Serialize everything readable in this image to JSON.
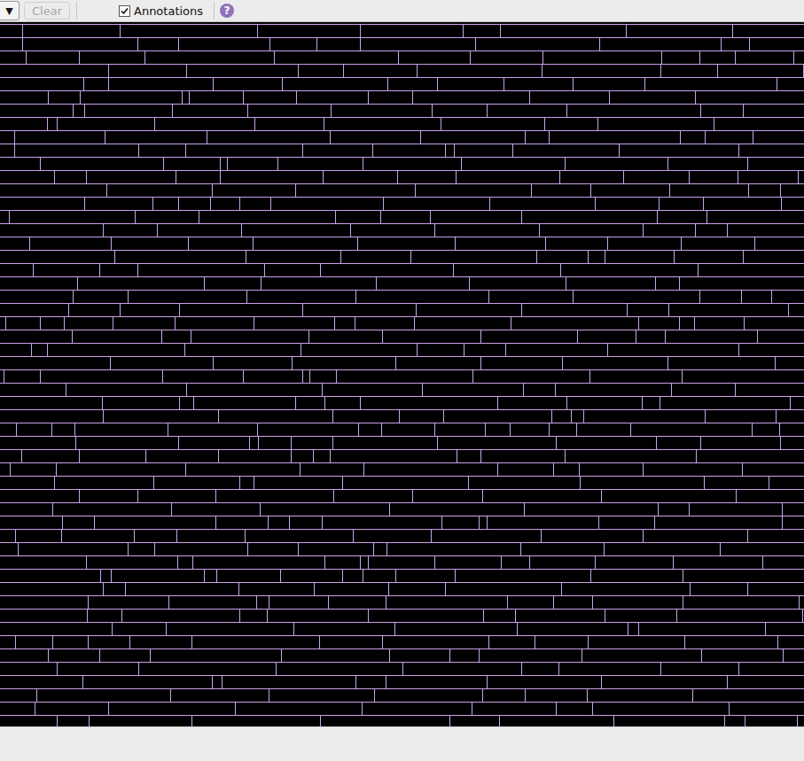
{
  "toolbar": {
    "dropdown": {
      "label": "▼"
    },
    "clear_button": {
      "label": "Clear",
      "disabled": true
    },
    "annotations": {
      "label": "Annotations",
      "checked": true
    },
    "help": {
      "label": "?"
    }
  }
}
